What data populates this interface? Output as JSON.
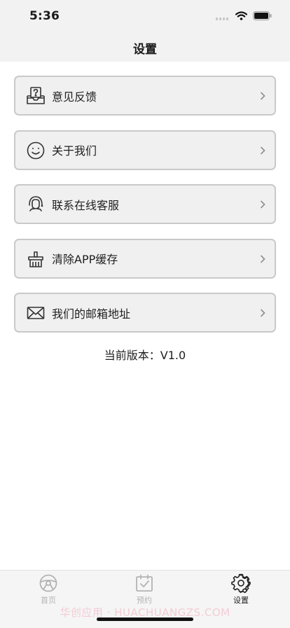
{
  "status_bar": {
    "time": "5:36"
  },
  "nav": {
    "title": "设置"
  },
  "menu": [
    {
      "label": "意见反馈",
      "icon": "feedback-icon"
    },
    {
      "label": "关于我们",
      "icon": "smiley-icon"
    },
    {
      "label": "联系在线客服",
      "icon": "customer-service-icon"
    },
    {
      "label": "清除APP缓存",
      "icon": "clear-cache-icon"
    },
    {
      "label": "我们的邮箱地址",
      "icon": "mail-icon"
    }
  ],
  "version_text": "当前版本：V1.0",
  "tabs": [
    {
      "label": "首页",
      "icon": "steering-wheel-icon",
      "active": false
    },
    {
      "label": "预约",
      "icon": "calendar-check-icon",
      "active": false
    },
    {
      "label": "设置",
      "icon": "gear-icon",
      "active": true
    }
  ],
  "watermark": "华创应用 · HUACHUANGZS.COM",
  "colors": {
    "background": "#ffffff",
    "nav_bar": "#f2f2f2",
    "row_bg": "#f0f0f0",
    "row_border": "#c9c9c9",
    "tab_inactive": "#b3b3b3",
    "tab_active": "#222222"
  }
}
